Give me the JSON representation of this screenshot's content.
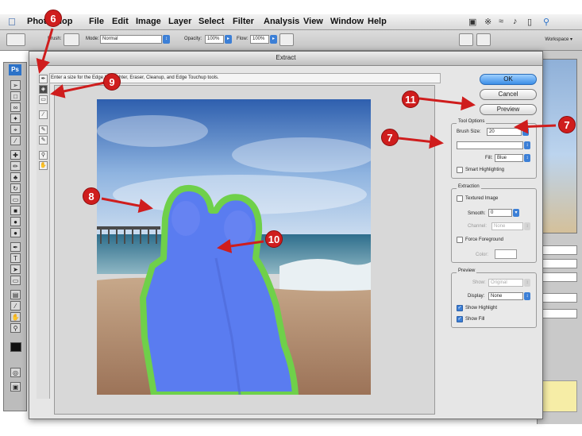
{
  "menubar": {
    "app_name": "Photoshop",
    "items": [
      "File",
      "Edit",
      "Image",
      "Layer",
      "Select",
      "Filter",
      "Analysis",
      "View",
      "Window",
      "Help"
    ]
  },
  "options_bar": {
    "brush_label": "Brush:",
    "mode_label": "Mode:",
    "mode_value": "Normal",
    "opacity_label": "Opacity:",
    "opacity_value": "100%",
    "flow_label": "Flow:",
    "flow_value": "100%",
    "workspace_label": "Workspace"
  },
  "dialog": {
    "title": "Extract",
    "hint_text": "Enter a size for the Edge Highlighter, Eraser, Cleanup, and Edge Touchup tools.",
    "buttons": {
      "ok": "OK",
      "cancel": "Cancel",
      "preview": "Preview"
    },
    "tool_options": {
      "title": "Tool Options",
      "brush_size_label": "Brush Size:",
      "brush_size_value": "20",
      "highlight_value": "",
      "fill_label": "Fill:",
      "fill_value": "Blue",
      "smart_highlighting_label": "Smart Highlighting"
    },
    "extraction": {
      "title": "Extraction",
      "textured_image_label": "Textured Image",
      "smooth_label": "Smooth:",
      "smooth_value": "0",
      "channel_label": "Channel:",
      "channel_value": "None",
      "force_foreground_label": "Force Foreground",
      "color_label": "Color:"
    },
    "preview": {
      "title": "Preview",
      "show_label": "Show:",
      "show_value": "Original",
      "display_label": "Display:",
      "display_value": "None",
      "show_highlight_label": "Show Highlight",
      "show_fill_label": "Show Fill",
      "show_highlight_checked": true,
      "show_fill_checked": true
    }
  },
  "callouts": [
    "6",
    "9",
    "11",
    "7",
    "7",
    "8",
    "10"
  ],
  "colors": {
    "callout": "#cf1d1d",
    "highlight_green": "#6fd04a",
    "fill_blue": "#5a7cf0",
    "accent_blue": "#3c7fd6"
  }
}
